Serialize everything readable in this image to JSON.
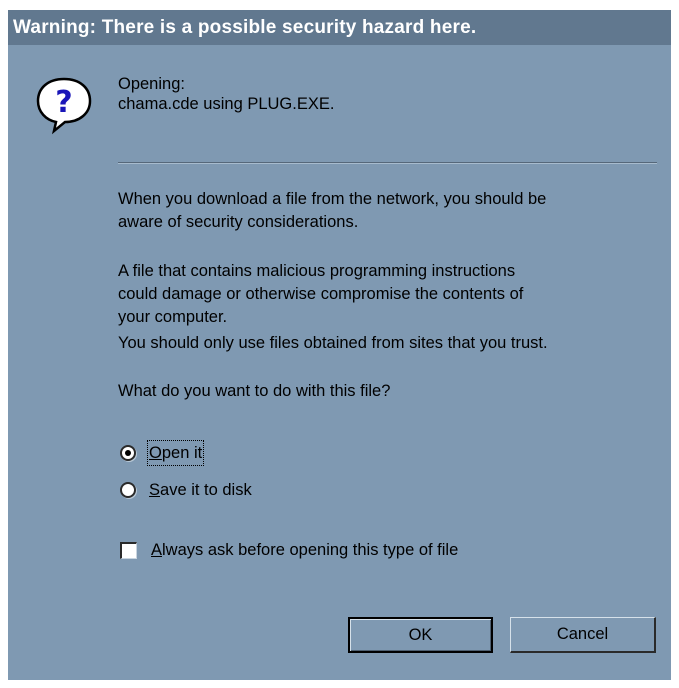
{
  "dialog": {
    "title": "Warning:  There is a possible security hazard here."
  },
  "header": {
    "icon": "question-balloon-icon",
    "opening_label": "Opening:",
    "file_line": "chama.cde using PLUG.EXE."
  },
  "body": {
    "paragraph_1_line_1": "When you download a file from the network, you should be",
    "paragraph_1_line_2": "aware of security considerations.",
    "paragraph_2_line_1": "A file that contains malicious programming instructions",
    "paragraph_2_line_2": "could damage or otherwise compromise the contents of",
    "paragraph_2_line_3": "your computer.",
    "paragraph_3": "You should only use files obtained from sites that you trust.",
    "question": "What do you want to do with this file?"
  },
  "options": {
    "open_it": {
      "mnemonic": "O",
      "rest": "pen it",
      "selected": true
    },
    "save_it": {
      "mnemonic": "S",
      "rest": "ave it to disk",
      "selected": false
    },
    "always_ask": {
      "mnemonic": "A",
      "rest": "lways ask before opening this type of file",
      "checked": false
    }
  },
  "buttons": {
    "ok_label": "OK",
    "cancel_label": "Cancel"
  },
  "colors": {
    "dialog_bg": "#7f99b2",
    "titlebar_bg": "#61788f",
    "titlebar_text": "#ffffff"
  }
}
